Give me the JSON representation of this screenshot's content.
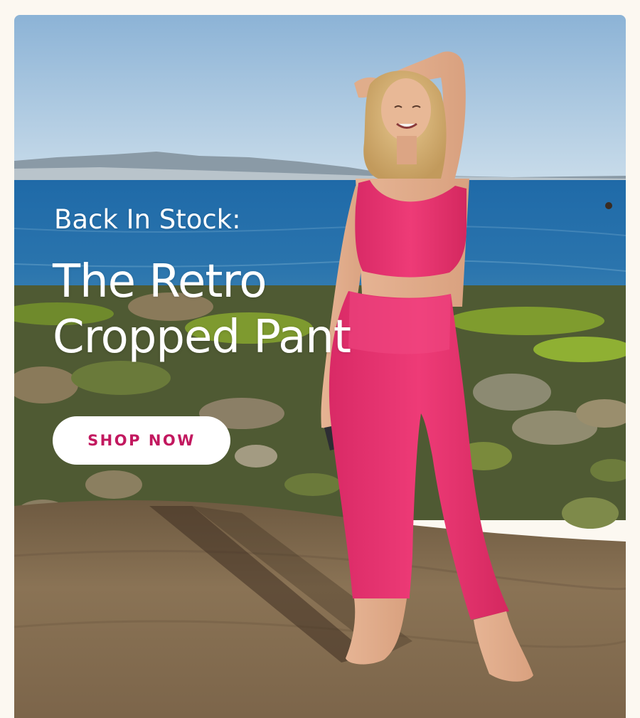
{
  "hero": {
    "eyebrow": "Back In Stock:",
    "headline_line1": "The Retro",
    "headline_line2": "Cropped Pant",
    "cta_label": "SHOP NOW"
  },
  "colors": {
    "page_background": "#fcf8f1",
    "cta_text": "#c2185f",
    "cta_background": "#ffffff",
    "outfit_pink": "#e8336f",
    "headline_text": "#ffffff"
  }
}
